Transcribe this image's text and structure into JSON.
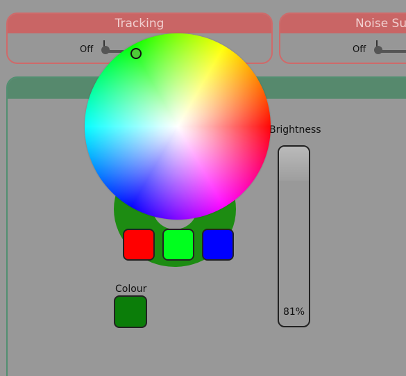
{
  "tracking_panel": {
    "title": "Tracking",
    "switch_label": "Off"
  },
  "noise_panel": {
    "title": "Noise Su",
    "switch_label": "Off"
  },
  "brightness": {
    "label": "Brightness",
    "value_text": "81%",
    "value": 81
  },
  "presets": [
    {
      "color": "#ff0000"
    },
    {
      "color": "#00ff1e"
    },
    {
      "color": "#0000ff"
    }
  ],
  "colour": {
    "label": "Colour",
    "value": "#0b7d09"
  },
  "colors": {
    "panel_red": "#c96565",
    "panel_green": "#56896d"
  },
  "icons": {
    "wheel_marker": "color-wheel-marker-icon"
  }
}
